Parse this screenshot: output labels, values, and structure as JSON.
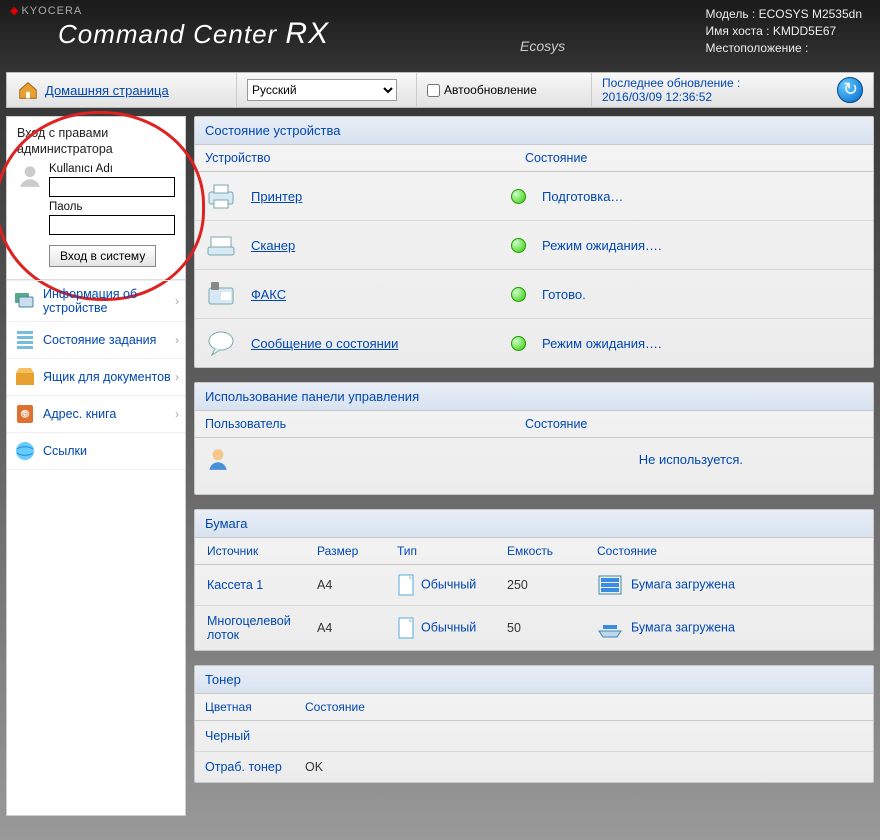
{
  "header": {
    "brand": "KYOCERA",
    "title": "Command Center RX",
    "ecosys": "Ecosys",
    "model_label": "Модель :",
    "model": "ECOSYS M2535dn",
    "host_label": "Имя хоста :",
    "host": "KMDD5E67",
    "loc_label": "Местоположение :",
    "loc": ""
  },
  "toolbar": {
    "home_link": "Домашняя страница",
    "language": "Русский",
    "auto_label": "Автообновление",
    "last_update_label": "Последнее обновление :",
    "last_update_time": "2016/03/09 12:36:52"
  },
  "login": {
    "title": "Вход с правами администратора",
    "user_label": "Kullanıcı Adı",
    "user_value": "",
    "pass_label": "Паоль",
    "pass_value": "",
    "button": "Вход в систему"
  },
  "nav": [
    {
      "label": "Информация об устройстве"
    },
    {
      "label": "Состояние задания"
    },
    {
      "label": "Ящик для документов"
    },
    {
      "label": "Адрес. книга"
    },
    {
      "label": "Ссылки"
    }
  ],
  "device_panel": {
    "title": "Состояние устройства",
    "col1": "Устройство",
    "col2": "Состояние",
    "rows": [
      {
        "name": "Принтер",
        "status": "Подготовка…"
      },
      {
        "name": "Сканер",
        "status": "Режим ожидания…."
      },
      {
        "name": "ФАКС",
        "status": "Готово."
      },
      {
        "name": "Сообщение о состоянии",
        "status": "Режим ожидания…."
      }
    ]
  },
  "usage_panel": {
    "title": "Использование панели управления",
    "col1": "Пользователь",
    "col2": "Состояние",
    "status": "Не используется."
  },
  "paper_panel": {
    "title": "Бумага",
    "cols": {
      "src": "Источник",
      "size": "Размер",
      "type": "Тип",
      "cap": "Емкость",
      "stat": "Состояние"
    },
    "rows": [
      {
        "src": "Кассета 1",
        "size": "A4",
        "type": "Обычный",
        "cap": "250",
        "stat": "Бумага загружена"
      },
      {
        "src": "Многоцелевой лоток",
        "size": "A4",
        "type": "Обычный",
        "cap": "50",
        "stat": "Бумага загружена"
      }
    ]
  },
  "toner_panel": {
    "title": "Тонер",
    "cols": {
      "c1": "Цветная",
      "c2": "Состояние"
    },
    "rows": [
      {
        "c1": "Черный",
        "c2": ""
      },
      {
        "c1": "Отраб. тонер",
        "c2": "OK"
      }
    ]
  }
}
